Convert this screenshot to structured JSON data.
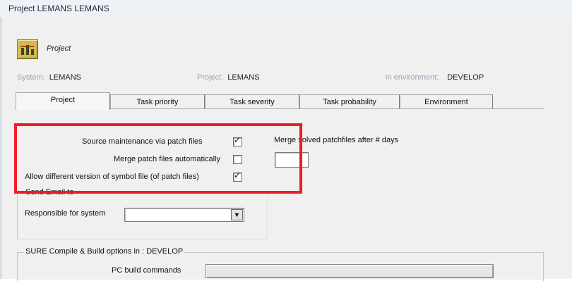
{
  "window": {
    "title": "Project LEMANS LEMANS"
  },
  "header": {
    "label": "Project",
    "icon": "project-icon"
  },
  "info": {
    "system_label": "System:",
    "system_value": "LEMANS",
    "project_label": "Project:",
    "project_value": "LEMANS",
    "env_label": "in environment:",
    "env_value": "DEVELOP"
  },
  "tabs": [
    "Project",
    "Task priority",
    "Task severity",
    "Task probability",
    "Environment"
  ],
  "options": {
    "source_maintenance": {
      "label": "Source maintenance via patch files",
      "checked": true
    },
    "merge_auto": {
      "label": "Merge patch files automatically",
      "checked": false
    },
    "allow_symbol": {
      "label": "Allow different version of symbol file (of patch files)",
      "checked": true
    },
    "merge_solved_label": "Merge solved patchfiles after # days",
    "merge_days_value": ""
  },
  "send_email": {
    "title": "Send Email to",
    "responsible_label": "Responsible for system",
    "responsible_value": ""
  },
  "compile": {
    "title": "SURE Compile & Build options in : DEVELOP",
    "pc_build_label": "PC build commands"
  },
  "colors": {
    "highlight": "#ee1c25"
  }
}
